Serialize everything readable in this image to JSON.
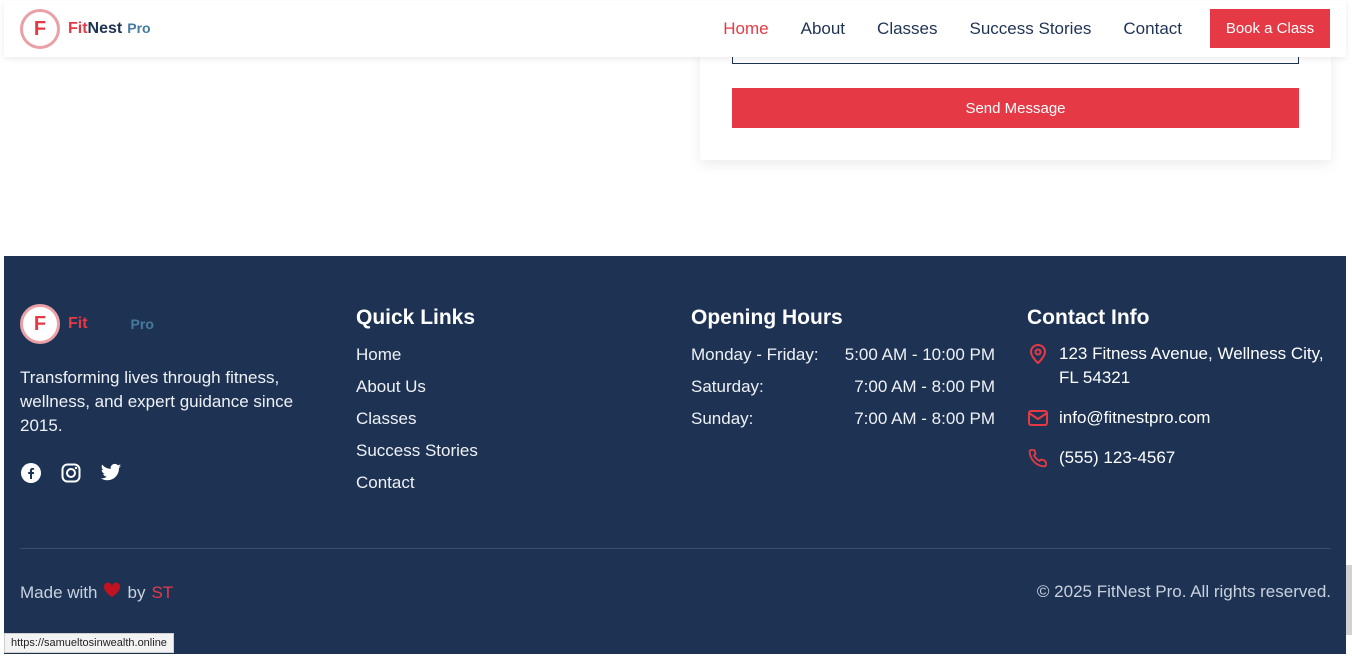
{
  "header": {
    "logo_letter": "F",
    "logo_fit": "Fit",
    "logo_nest": "Nest",
    "logo_pro": "Pro",
    "nav": [
      {
        "label": "Home",
        "active": true
      },
      {
        "label": "About"
      },
      {
        "label": "Classes"
      },
      {
        "label": "Success Stories"
      },
      {
        "label": "Contact"
      }
    ],
    "book_label": "Book a Class"
  },
  "contact_form": {
    "send_label": "Send Message"
  },
  "footer": {
    "logo_letter": "F",
    "logo_fit": "Fit",
    "logo_pro": "Pro",
    "tagline": "Transforming lives through fitness, wellness, and expert guidance since 2015.",
    "social_icons": [
      "facebook-icon",
      "instagram-icon",
      "twitter-icon"
    ],
    "quick_links": {
      "title": "Quick Links",
      "items": [
        "Home",
        "About Us",
        "Classes",
        "Success Stories",
        "Contact"
      ]
    },
    "opening_hours": {
      "title": "Opening Hours",
      "rows": [
        {
          "day": "Monday - Friday:",
          "time": "5:00 AM - 10:00 PM"
        },
        {
          "day": "Saturday:",
          "time": "7:00 AM - 8:00 PM"
        },
        {
          "day": "Sunday:",
          "time": "7:00 AM - 8:00 PM"
        }
      ]
    },
    "contact_info": {
      "title": "Contact Info",
      "address": "123 Fitness Avenue, Wellness City, FL 54321",
      "email": "info@fitnestpro.com",
      "phone": "(555) 123-4567"
    },
    "made_with": "Made with",
    "by": "by",
    "author": "ST",
    "copyright": "© 2025 FitNest Pro. All rights reserved."
  },
  "status_bar": {
    "url": "https://samueltosinwealth.online"
  },
  "colors": {
    "accent": "#e63946",
    "navy": "#1e3354",
    "pro_blue": "#457b9d"
  }
}
